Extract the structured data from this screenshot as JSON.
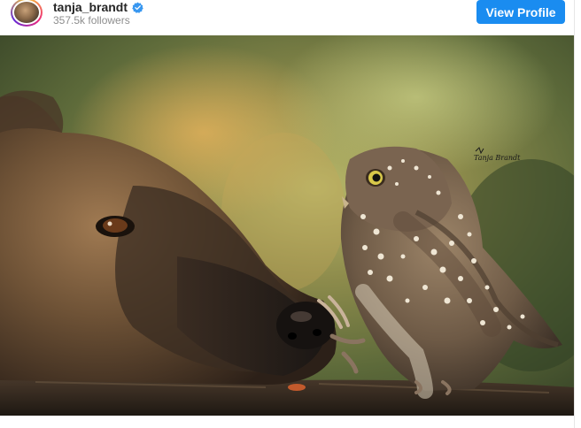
{
  "header": {
    "username": "tanja_brandt",
    "followers": "357.5k followers",
    "view_profile_label": "View Profile"
  },
  "colors": {
    "button": "#1a8cf0",
    "verified": "#3897f0",
    "username": "#262626",
    "subtext": "#8e8e8e"
  },
  "photo": {
    "signature": "Tanja Brandt"
  }
}
